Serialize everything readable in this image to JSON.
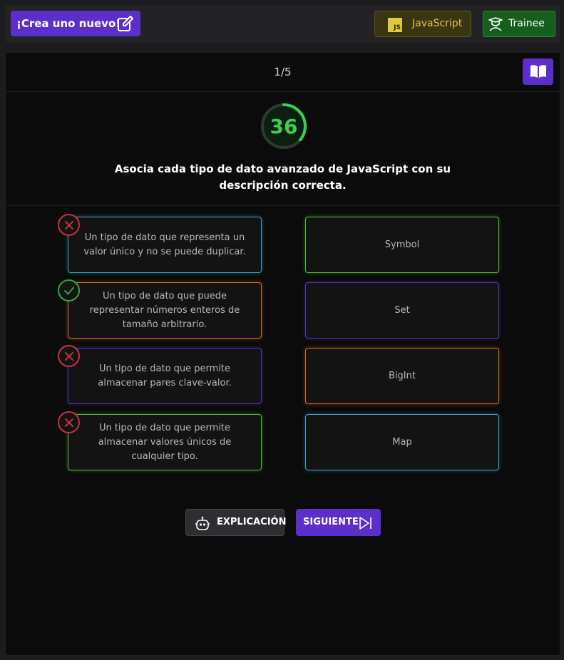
{
  "topbar": {
    "create_label": "¡Crea uno nuevo!",
    "create_icon": "edit-icon",
    "language_label": "JavaScript",
    "language_badge": "JS",
    "level_label": "Trainee",
    "level_icon": "trainee-icon"
  },
  "header": {
    "counter": "1/5",
    "book_icon": "book-icon"
  },
  "score": {
    "value": "36",
    "progress": 0.36,
    "color": "#38d24d"
  },
  "question": "Asocia cada tipo de dato avanzado de JavaScript con su descripción correcta.",
  "left_items": [
    {
      "text": "Un tipo de dato que representa un valor único y no se puede duplicar.",
      "status": "wrong",
      "color": "#3aa7c8"
    },
    {
      "text": "Un tipo de dato que puede representar números enteros de tamaño arbitrario.",
      "status": "correct",
      "color": "#e06a2c"
    },
    {
      "text": "Un tipo de dato que permite almacenar pares clave-valor.",
      "status": "wrong",
      "color": "#5b2fc9"
    },
    {
      "text": "Un tipo de dato que permite almacenar valores únicos de cualquier tipo.",
      "status": "wrong",
      "color": "#4fbf3c"
    }
  ],
  "right_items": [
    {
      "text": "Symbol",
      "color": "#4fbf3c"
    },
    {
      "text": "Set",
      "color": "#5b2fc9"
    },
    {
      "text": "BigInt",
      "color": "#e06a2c"
    },
    {
      "text": "Map",
      "color": "#3aa7c8"
    }
  ],
  "actions": {
    "explain_label": "EXPLICACIÓN",
    "explain_icon": "robot-icon",
    "next_label": "SIGUIENTE",
    "next_icon": "skip-next-icon"
  },
  "colors": {
    "accent": "#5b2fc9",
    "wrong": "#c8303d",
    "correct": "#2fa53a"
  }
}
